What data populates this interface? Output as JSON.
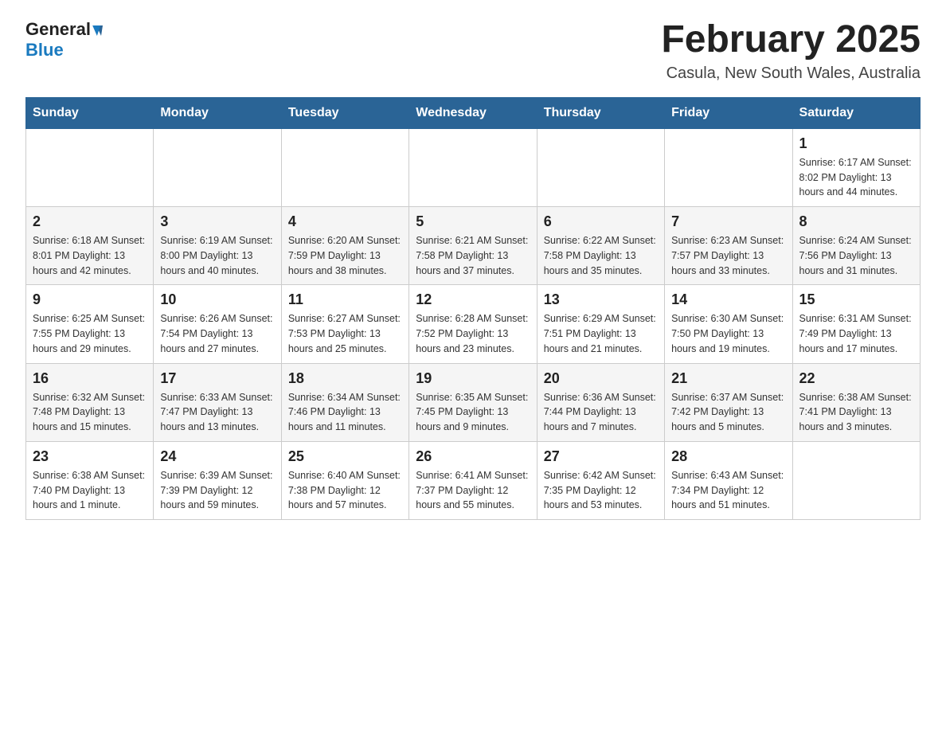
{
  "header": {
    "logo_general": "General",
    "logo_blue": "Blue",
    "month_title": "February 2025",
    "location": "Casula, New South Wales, Australia"
  },
  "days_of_week": [
    "Sunday",
    "Monday",
    "Tuesday",
    "Wednesday",
    "Thursday",
    "Friday",
    "Saturday"
  ],
  "weeks": [
    [
      {
        "day": "",
        "info": ""
      },
      {
        "day": "",
        "info": ""
      },
      {
        "day": "",
        "info": ""
      },
      {
        "day": "",
        "info": ""
      },
      {
        "day": "",
        "info": ""
      },
      {
        "day": "",
        "info": ""
      },
      {
        "day": "1",
        "info": "Sunrise: 6:17 AM\nSunset: 8:02 PM\nDaylight: 13 hours and 44 minutes."
      }
    ],
    [
      {
        "day": "2",
        "info": "Sunrise: 6:18 AM\nSunset: 8:01 PM\nDaylight: 13 hours and 42 minutes."
      },
      {
        "day": "3",
        "info": "Sunrise: 6:19 AM\nSunset: 8:00 PM\nDaylight: 13 hours and 40 minutes."
      },
      {
        "day": "4",
        "info": "Sunrise: 6:20 AM\nSunset: 7:59 PM\nDaylight: 13 hours and 38 minutes."
      },
      {
        "day": "5",
        "info": "Sunrise: 6:21 AM\nSunset: 7:58 PM\nDaylight: 13 hours and 37 minutes."
      },
      {
        "day": "6",
        "info": "Sunrise: 6:22 AM\nSunset: 7:58 PM\nDaylight: 13 hours and 35 minutes."
      },
      {
        "day": "7",
        "info": "Sunrise: 6:23 AM\nSunset: 7:57 PM\nDaylight: 13 hours and 33 minutes."
      },
      {
        "day": "8",
        "info": "Sunrise: 6:24 AM\nSunset: 7:56 PM\nDaylight: 13 hours and 31 minutes."
      }
    ],
    [
      {
        "day": "9",
        "info": "Sunrise: 6:25 AM\nSunset: 7:55 PM\nDaylight: 13 hours and 29 minutes."
      },
      {
        "day": "10",
        "info": "Sunrise: 6:26 AM\nSunset: 7:54 PM\nDaylight: 13 hours and 27 minutes."
      },
      {
        "day": "11",
        "info": "Sunrise: 6:27 AM\nSunset: 7:53 PM\nDaylight: 13 hours and 25 minutes."
      },
      {
        "day": "12",
        "info": "Sunrise: 6:28 AM\nSunset: 7:52 PM\nDaylight: 13 hours and 23 minutes."
      },
      {
        "day": "13",
        "info": "Sunrise: 6:29 AM\nSunset: 7:51 PM\nDaylight: 13 hours and 21 minutes."
      },
      {
        "day": "14",
        "info": "Sunrise: 6:30 AM\nSunset: 7:50 PM\nDaylight: 13 hours and 19 minutes."
      },
      {
        "day": "15",
        "info": "Sunrise: 6:31 AM\nSunset: 7:49 PM\nDaylight: 13 hours and 17 minutes."
      }
    ],
    [
      {
        "day": "16",
        "info": "Sunrise: 6:32 AM\nSunset: 7:48 PM\nDaylight: 13 hours and 15 minutes."
      },
      {
        "day": "17",
        "info": "Sunrise: 6:33 AM\nSunset: 7:47 PM\nDaylight: 13 hours and 13 minutes."
      },
      {
        "day": "18",
        "info": "Sunrise: 6:34 AM\nSunset: 7:46 PM\nDaylight: 13 hours and 11 minutes."
      },
      {
        "day": "19",
        "info": "Sunrise: 6:35 AM\nSunset: 7:45 PM\nDaylight: 13 hours and 9 minutes."
      },
      {
        "day": "20",
        "info": "Sunrise: 6:36 AM\nSunset: 7:44 PM\nDaylight: 13 hours and 7 minutes."
      },
      {
        "day": "21",
        "info": "Sunrise: 6:37 AM\nSunset: 7:42 PM\nDaylight: 13 hours and 5 minutes."
      },
      {
        "day": "22",
        "info": "Sunrise: 6:38 AM\nSunset: 7:41 PM\nDaylight: 13 hours and 3 minutes."
      }
    ],
    [
      {
        "day": "23",
        "info": "Sunrise: 6:38 AM\nSunset: 7:40 PM\nDaylight: 13 hours and 1 minute."
      },
      {
        "day": "24",
        "info": "Sunrise: 6:39 AM\nSunset: 7:39 PM\nDaylight: 12 hours and 59 minutes."
      },
      {
        "day": "25",
        "info": "Sunrise: 6:40 AM\nSunset: 7:38 PM\nDaylight: 12 hours and 57 minutes."
      },
      {
        "day": "26",
        "info": "Sunrise: 6:41 AM\nSunset: 7:37 PM\nDaylight: 12 hours and 55 minutes."
      },
      {
        "day": "27",
        "info": "Sunrise: 6:42 AM\nSunset: 7:35 PM\nDaylight: 12 hours and 53 minutes."
      },
      {
        "day": "28",
        "info": "Sunrise: 6:43 AM\nSunset: 7:34 PM\nDaylight: 12 hours and 51 minutes."
      },
      {
        "day": "",
        "info": ""
      }
    ]
  ]
}
